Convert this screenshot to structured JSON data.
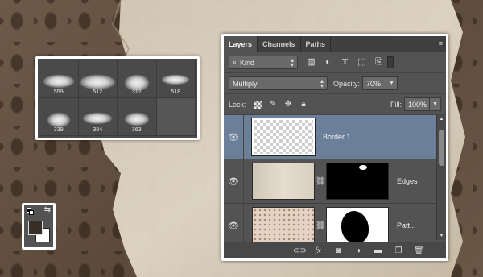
{
  "brush_presets": [
    {
      "size": "559"
    },
    {
      "size": "512"
    },
    {
      "size": "312"
    },
    {
      "size": "518"
    },
    {
      "size": "339"
    },
    {
      "size": "384"
    },
    {
      "size": "363"
    }
  ],
  "layers_panel": {
    "tabs": [
      "Layers",
      "Channels",
      "Paths"
    ],
    "active_tab": "Layers",
    "filter": {
      "kind_label": "Kind"
    },
    "blend_mode": "Multiply",
    "opacity_label": "Opacity:",
    "opacity_value": "70%",
    "lock_label": "Lock:",
    "fill_label": "Fill:",
    "fill_value": "100%",
    "layers": [
      {
        "name": "Border 1",
        "selected": true
      },
      {
        "name": "Edges",
        "selected": false
      },
      {
        "name": "Patt...",
        "selected": false
      }
    ]
  },
  "colors": {
    "selected_layer": "#6b7f98",
    "foreground": "#3a2e28",
    "background": "#ffffff",
    "panel_bg": "#535353"
  }
}
